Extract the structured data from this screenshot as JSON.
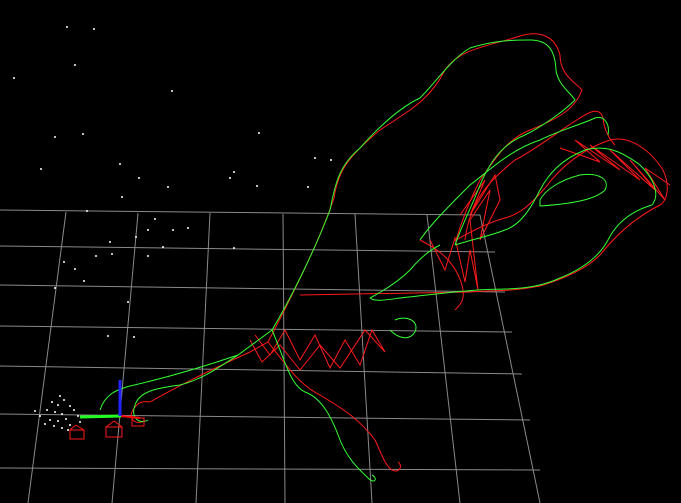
{
  "viewer": {
    "background_color": "#000000",
    "grid_color": "#8a8a8a",
    "landmark_color": "#ffffff",
    "trajectory_estimate_color": "#ff1a1a",
    "trajectory_groundtruth_color": "#33ff33",
    "axis_colors": {
      "x": "#ff0000",
      "y": "#22ff22",
      "z": "#2222ff"
    }
  },
  "icons": {
    "origin_axes": "xyz-axes-icon",
    "camera_frustums": "camera-frustum-icon"
  }
}
